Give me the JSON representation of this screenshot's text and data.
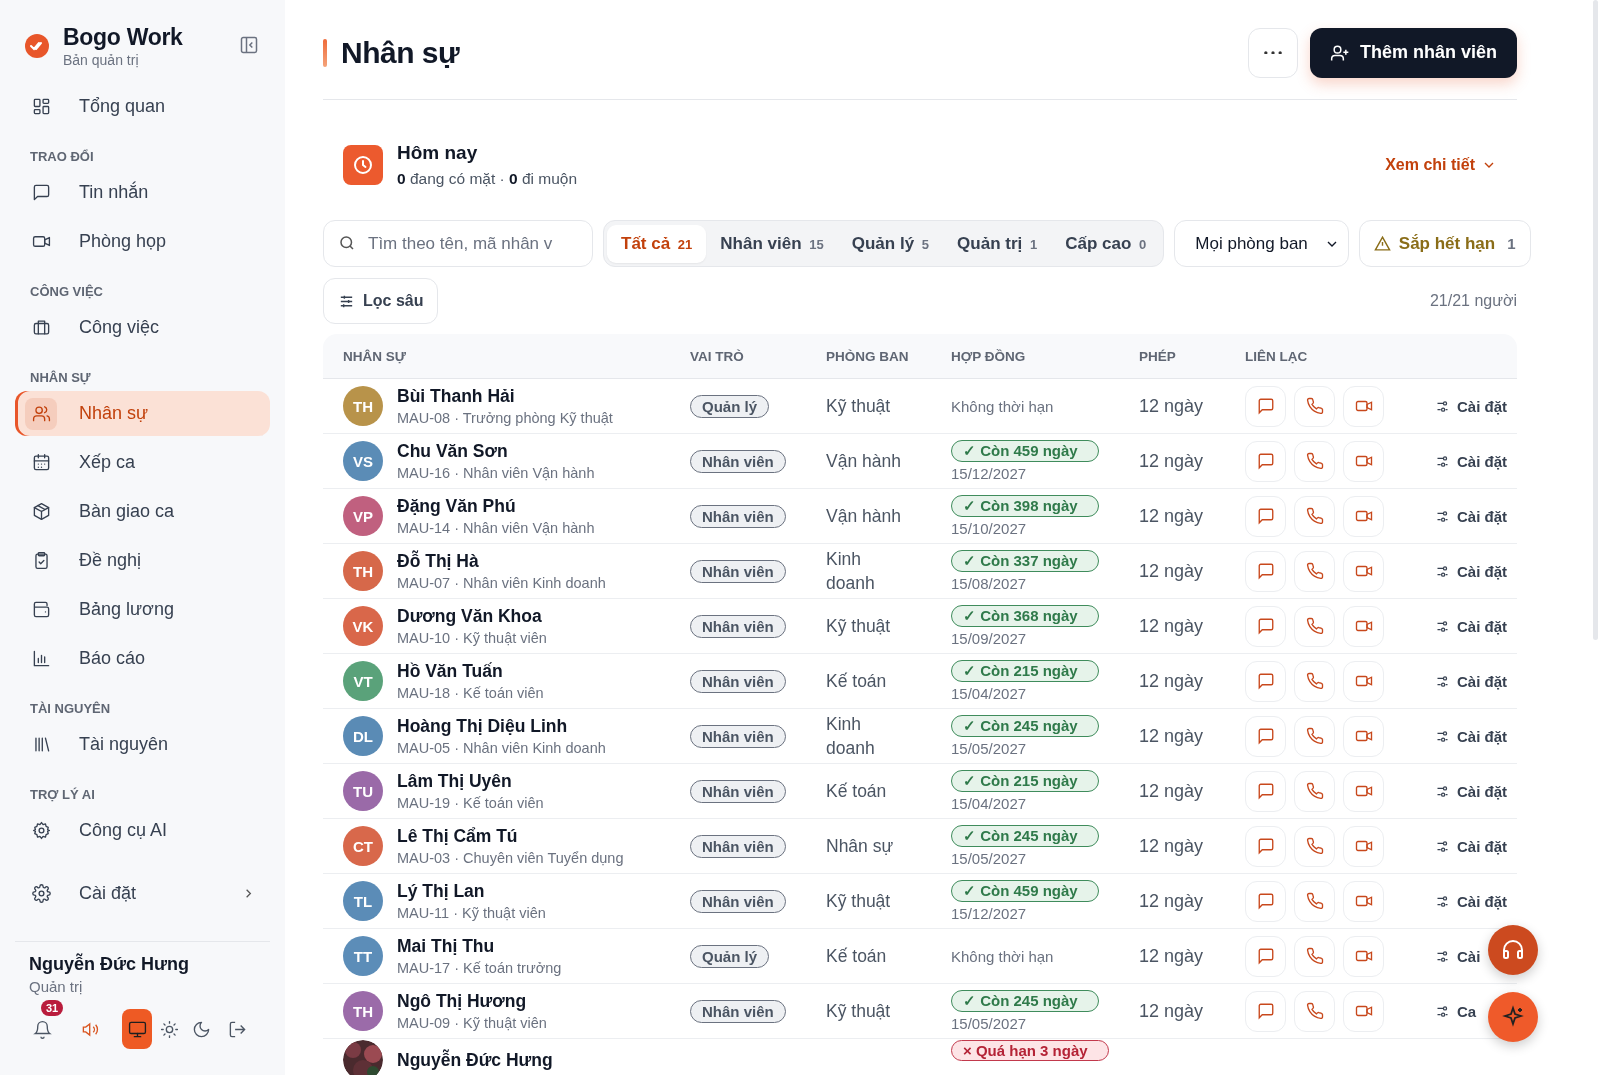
{
  "sidebar": {
    "brand": {
      "name": "Bogo Work",
      "subtitle": "Bản quản trị"
    },
    "sections": [
      {
        "items": [
          {
            "label": "Tổng quan",
            "selected": false
          }
        ]
      },
      {
        "title": "TRAO ĐỔI",
        "items": [
          {
            "label": "Tin nhắn",
            "selected": false
          },
          {
            "label": "Phòng họp",
            "selected": false
          }
        ]
      },
      {
        "title": "CÔNG VIỆC",
        "items": [
          {
            "label": "Công việc",
            "selected": false
          }
        ]
      },
      {
        "title": "NHÂN SỰ",
        "items": [
          {
            "label": "Nhân sự",
            "selected": true
          },
          {
            "label": "Xếp ca",
            "selected": false
          },
          {
            "label": "Bàn giao ca",
            "selected": false
          },
          {
            "label": "Đề nghị",
            "selected": false
          },
          {
            "label": "Bảng lương",
            "selected": false
          },
          {
            "label": "Báo cáo",
            "selected": false
          }
        ]
      },
      {
        "title": "TÀI NGUYÊN",
        "items": [
          {
            "label": "Tài nguyên",
            "selected": false
          }
        ]
      },
      {
        "title": "TRỢ LÝ AI",
        "items": [
          {
            "label": "Công cụ AI",
            "selected": false
          }
        ]
      },
      {
        "items": [
          {
            "label": "Cài đặt",
            "selected": false,
            "expandable": true
          }
        ]
      }
    ],
    "user": {
      "name": "Nguyễn Đức Hưng",
      "role": "Quản trị"
    },
    "notifications": {
      "count": "31"
    },
    "sound": {
      "on": true
    },
    "themes": [
      {
        "selected": true
      },
      {
        "selected": false
      },
      {
        "selected": false
      }
    ]
  },
  "page": {
    "title": "Nhân sự",
    "add_button": "Thêm nhân viên"
  },
  "today": {
    "title": "Hôm nay",
    "summary": "**0** đang có mặt · **0** đi muộn",
    "detail_link": "Xem chi tiết"
  },
  "search": {
    "placeholder": "Tìm theo tên, mã nhân v"
  },
  "tabs": [
    {
      "label": "Tất cả",
      "count": "21",
      "selected": true
    },
    {
      "label": "Nhân viên",
      "count": "15",
      "selected": false
    },
    {
      "label": "Quản lý",
      "count": "5",
      "selected": false
    },
    {
      "label": "Quản trị",
      "count": "1",
      "selected": false
    },
    {
      "label": "Cấp cao",
      "count": "0",
      "selected": false
    }
  ],
  "department_filter": {
    "value": "Mọi phòng ban"
  },
  "expiring_filter": {
    "label": "Sắp hết hạn",
    "count": "1"
  },
  "advanced_filter": "Lọc sâu",
  "result_count": "21/21 người",
  "table": {
    "columns": [
      "NHÂN SỰ",
      "VAI TRÒ",
      "PHÒNG BAN",
      "HỢP ĐỒNG",
      "PHÉP",
      "LIÊN LẠC"
    ],
    "rows": [
      {
        "initials": "TH",
        "color": "#b8934a",
        "name": "Bùi Thanh Hải",
        "detail": "MAU-08 · Trưởng phòng Kỹ thuật",
        "role": "Quản lý",
        "department": "Kỹ thuật",
        "contract": {
          "kind": "none",
          "text": "Không thời hạn"
        },
        "leave": "12 ngày",
        "settings": "Cài đặt"
      },
      {
        "initials": "VS",
        "color": "#5b8cb6",
        "name": "Chu Văn Sơn",
        "detail": "MAU-16 · Nhân viên Vận hành",
        "role": "Nhân viên",
        "department": "Vận hành",
        "contract": {
          "kind": "active",
          "text": "✓ Còn 459 ngày",
          "date": "15/12/2027"
        },
        "leave": "12 ngày",
        "settings": "Cài đặt"
      },
      {
        "initials": "VP",
        "color": "#c0607f",
        "name": "Đặng Văn Phú",
        "detail": "MAU-14 · Nhân viên Vận hành",
        "role": "Nhân viên",
        "department": "Vận hành",
        "contract": {
          "kind": "active",
          "text": "✓ Còn 398 ngày",
          "date": "15/10/2027"
        },
        "leave": "12 ngày",
        "settings": "Cài đặt"
      },
      {
        "initials": "TH",
        "color": "#d6684a",
        "name": "Đỗ Thị Hà",
        "detail": "MAU-07 · Nhân viên Kinh doanh",
        "role": "Nhân viên",
        "department": "Kinh doanh",
        "contract": {
          "kind": "active",
          "text": "✓ Còn 337 ngày",
          "date": "15/08/2027"
        },
        "leave": "12 ngày",
        "settings": "Cài đặt"
      },
      {
        "initials": "VK",
        "color": "#d9674a",
        "name": "Dương Văn Khoa",
        "detail": "MAU-10 · Kỹ thuật viên",
        "role": "Nhân viên",
        "department": "Kỹ thuật",
        "contract": {
          "kind": "active",
          "text": "✓ Còn 368 ngày",
          "date": "15/09/2027"
        },
        "leave": "12 ngày",
        "settings": "Cài đặt"
      },
      {
        "initials": "VT",
        "color": "#5aa27a",
        "name": "Hồ Văn Tuấn",
        "detail": "MAU-18 · Kế toán viên",
        "role": "Nhân viên",
        "department": "Kế toán",
        "contract": {
          "kind": "active",
          "text": "✓ Còn 215 ngày",
          "date": "15/04/2027"
        },
        "leave": "12 ngày",
        "settings": "Cài đặt"
      },
      {
        "initials": "DL",
        "color": "#5a8bb5",
        "name": "Hoàng Thị Diệu Linh",
        "detail": "MAU-05 · Nhân viên Kinh doanh",
        "role": "Nhân viên",
        "department": "Kinh doanh",
        "contract": {
          "kind": "active",
          "text": "✓ Còn 245 ngày",
          "date": "15/05/2027"
        },
        "leave": "12 ngày",
        "settings": "Cài đặt"
      },
      {
        "initials": "TU",
        "color": "#9a6aa8",
        "name": "Lâm Thị Uyên",
        "detail": "MAU-19 · Kế toán viên",
        "role": "Nhân viên",
        "department": "Kế toán",
        "contract": {
          "kind": "active",
          "text": "✓ Còn 215 ngày",
          "date": "15/04/2027"
        },
        "leave": "12 ngày",
        "settings": "Cài đặt"
      },
      {
        "initials": "CT",
        "color": "#d8684b",
        "name": "Lê Thị Cẩm Tú",
        "detail": "MAU-03 · Chuyên viên Tuyển dụng",
        "role": "Nhân viên",
        "department": "Nhân sự",
        "contract": {
          "kind": "active",
          "text": "✓ Còn 245 ngày",
          "date": "15/05/2027"
        },
        "leave": "12 ngày",
        "settings": "Cài đặt"
      },
      {
        "initials": "TL",
        "color": "#5b8cb7",
        "name": "Lý Thị Lan",
        "detail": "MAU-11 · Kỹ thuật viên",
        "role": "Nhân viên",
        "department": "Kỹ thuật",
        "contract": {
          "kind": "active",
          "text": "✓ Còn 459 ngày",
          "date": "15/12/2027"
        },
        "leave": "12 ngày",
        "settings": "Cài đặt"
      },
      {
        "initials": "TT",
        "color": "#5c8db8",
        "name": "Mai Thị Thu",
        "detail": "MAU-17 · Kế toán trưởng",
        "role": "Quản lý",
        "department": "Kế toán",
        "contract": {
          "kind": "none",
          "text": "Không thời hạn"
        },
        "leave": "12 ngày",
        "settings": "Cài"
      },
      {
        "initials": "TH",
        "color": "#9b6ba9",
        "name": "Ngô Thị Hương",
        "detail": "MAU-09 · Kỹ thuật viên",
        "role": "Nhân viên",
        "department": "Kỹ thuật",
        "contract": {
          "kind": "active",
          "text": "✓ Còn 245 ngày",
          "date": "15/05/2027"
        },
        "leave": "12 ngày",
        "settings": "Ca"
      },
      {
        "name": "Nguyễn Đức Hưng",
        "contract": {
          "kind": "expired",
          "text": "× Quá hạn 3 ngày"
        }
      }
    ]
  }
}
